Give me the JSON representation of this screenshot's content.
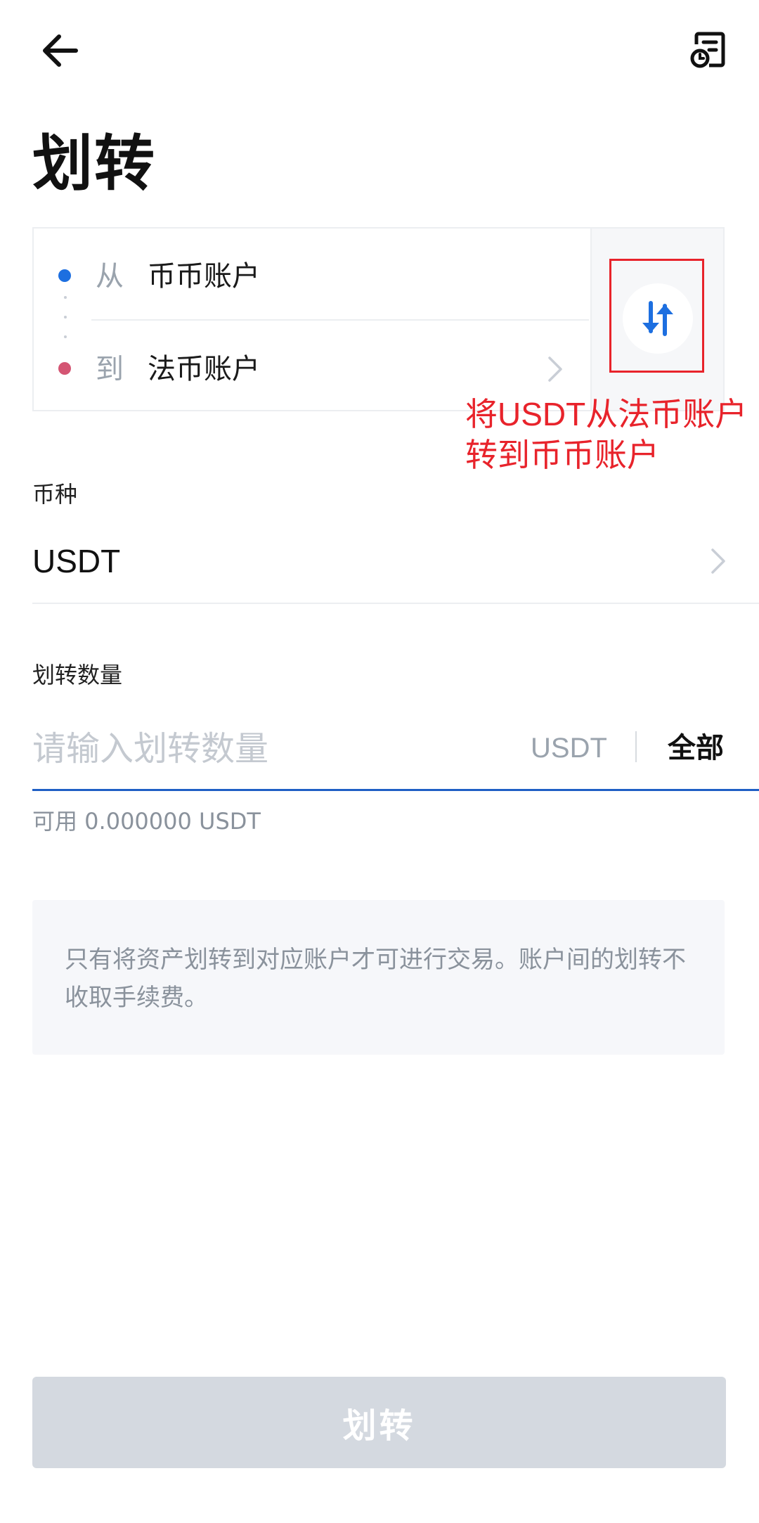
{
  "header": {
    "back_icon": "back-arrow-icon",
    "history_icon": "transfer-history-icon",
    "title": "划转"
  },
  "accounts": {
    "from_label": "从",
    "from_value": "币币账户",
    "to_label": "到",
    "to_value": "法币账户",
    "swap_icon": "swap-arrows-icon",
    "from_dot_color": "#1d6fe0",
    "to_dot_color": "#d45573"
  },
  "annotation": {
    "text": "将USDT从法币账户转到币币账户",
    "color": "#e8232b"
  },
  "currency": {
    "label": "币种",
    "value": "USDT"
  },
  "amount": {
    "label": "划转数量",
    "placeholder": "请输入划转数量",
    "unit": "USDT",
    "all_label": "全部",
    "available": "可用 0.000000 USDT",
    "accent_color": "#1f5fc5"
  },
  "notice": {
    "text": "只有将资产划转到对应账户才可进行交易。账户间的划转不收取手续费。"
  },
  "submit": {
    "label": "划转",
    "disabled_color": "#d4d9e0"
  }
}
